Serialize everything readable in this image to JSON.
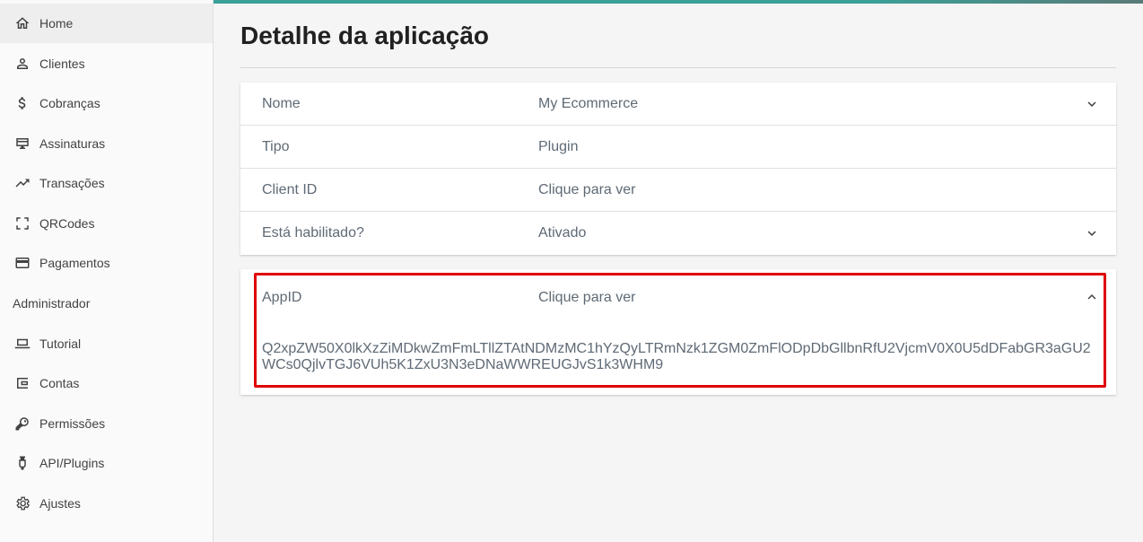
{
  "sidebar": {
    "items": [
      {
        "label": "Home",
        "icon": "home-icon"
      },
      {
        "label": "Clientes",
        "icon": "person-icon"
      },
      {
        "label": "Cobranças",
        "icon": "dollar-icon"
      },
      {
        "label": "Assinaturas",
        "icon": "subscription-icon"
      },
      {
        "label": "Transações",
        "icon": "trending-up-icon"
      },
      {
        "label": "QRCodes",
        "icon": "qr-scan-icon"
      },
      {
        "label": "Pagamentos",
        "icon": "credit-card-icon"
      }
    ],
    "section_label": "Administrador",
    "admin_items": [
      {
        "label": "Tutorial",
        "icon": "laptop-icon"
      },
      {
        "label": "Contas",
        "icon": "wallet-icon"
      },
      {
        "label": "Permissões",
        "icon": "key-icon"
      },
      {
        "label": "API/Plugins",
        "icon": "plug-icon"
      },
      {
        "label": "Ajustes",
        "icon": "gear-icon"
      }
    ]
  },
  "page": {
    "title": "Detalhe da aplicação"
  },
  "details": [
    {
      "label": "Nome",
      "value": "My Ecommerce"
    },
    {
      "label": "Tipo",
      "value": "Plugin"
    },
    {
      "label": "Client ID",
      "value": "Clique para ver"
    },
    {
      "label": "Está habilitado?",
      "value": "Ativado"
    }
  ],
  "appid": {
    "label": "AppID",
    "value": "Clique para ver",
    "token": "Q2xpZW50X0lkXzZiMDkwZmFmLTllZTAtNDMzMC1hYzQyLTRmNzk1ZGM0ZmFlODpDbGllbnRfU2VjcmV0X0U5dDFabGR3aGU2WCs0QjlvTGJ6VUh5K1ZxU3N3eDNaWWREUGJvS1k3WHM9"
  },
  "colors": {
    "accent": "#3aa198",
    "highlight_border": "#e00000"
  }
}
